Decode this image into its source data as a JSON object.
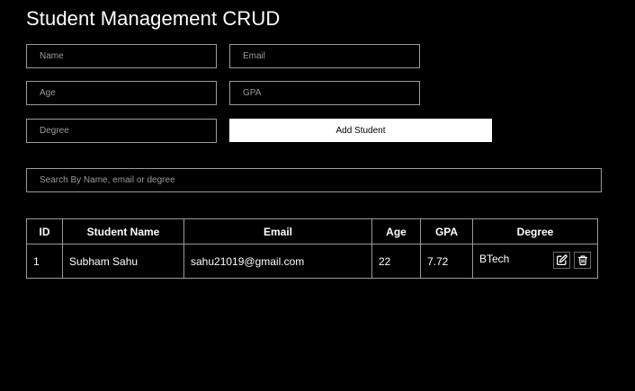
{
  "title": "Student Management CRUD",
  "form": {
    "name_placeholder": "Name",
    "email_placeholder": "Email",
    "age_placeholder": "Age",
    "gpa_placeholder": "GPA",
    "degree_placeholder": "Degree",
    "add_button": "Add Student"
  },
  "search": {
    "placeholder": "Search By Name, email or degree"
  },
  "table": {
    "headers": {
      "id": "ID",
      "name": "Student Name",
      "email": "Email",
      "age": "Age",
      "gpa": "GPA",
      "degree": "Degree"
    },
    "rows": [
      {
        "id": "1",
        "name": "Subham Sahu",
        "email": "sahu21019@gmail.com",
        "age": "22",
        "gpa": "7.72",
        "degree": "BTech",
        "actions": [
          "edit-icon",
          "trash-icon"
        ]
      }
    ]
  },
  "colors": {
    "background": "#000000",
    "border": "#9a9a9a",
    "button_bg": "#ffffff",
    "button_text": "#000000"
  }
}
